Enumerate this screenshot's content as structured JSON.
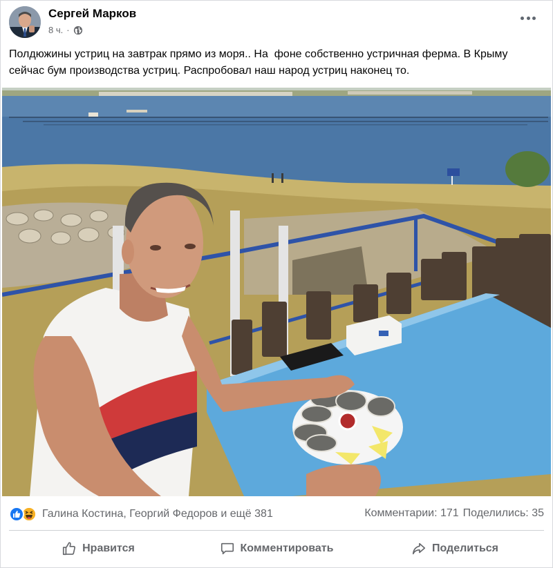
{
  "post": {
    "author": "Сергей Марков",
    "time": "8 ч.",
    "privacy_icon": "globe-icon",
    "more_icon": "more-options-icon",
    "text": "Полдюжины устриц на завтрак прямо из моря.. На  фоне собственно устричная ферма. В Крыму сейчас бум производства устриц. Распробовал наш народ устриц наконец то."
  },
  "reactions": {
    "icons": [
      "like-icon",
      "haha-icon"
    ],
    "names": "Галина Костина, Георгий Федоров и ещё 381",
    "comments": "Комментарии: 171",
    "shares": "Поделились: 35"
  },
  "actions": {
    "like": "Нравится",
    "comment": "Комментировать",
    "share": "Поделиться"
  },
  "colors": {
    "accent": "#1877f2",
    "secondary_text": "#65676b",
    "divider": "#ced0d4"
  }
}
